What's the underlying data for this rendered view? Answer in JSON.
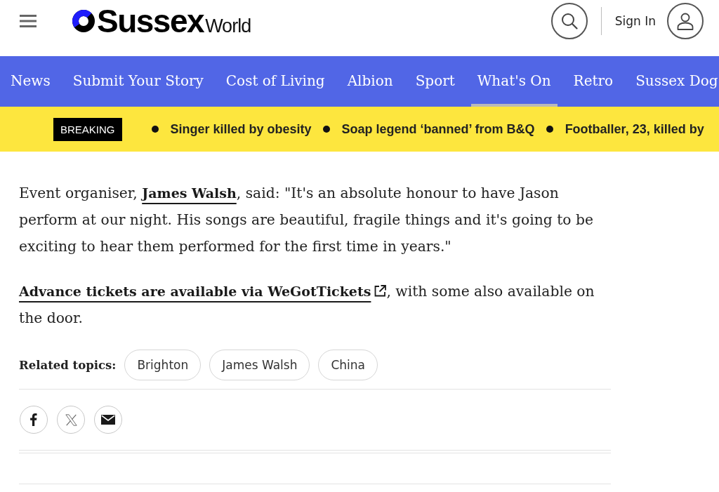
{
  "header": {
    "logo": {
      "wordmark": "Sussex",
      "suffix": "World"
    },
    "sign_in": "Sign In"
  },
  "nav": {
    "items": [
      {
        "label": "News",
        "selected": false
      },
      {
        "label": "Submit Your Story",
        "selected": false
      },
      {
        "label": "Cost of Living",
        "selected": false
      },
      {
        "label": "Albion",
        "selected": false
      },
      {
        "label": "Sport",
        "selected": false
      },
      {
        "label": "What's On",
        "selected": true
      },
      {
        "label": "Retro",
        "selected": false
      },
      {
        "label": "Sussex Dog",
        "selected": false
      }
    ]
  },
  "breaking_news": {
    "label": "BREAKING",
    "headlines": [
      "Singer killed by obesity",
      "Soap legend ‘banned’ from B&Q",
      "Footballer, 23, killed by"
    ]
  },
  "article": {
    "paragraphs": [
      {
        "parts": [
          {
            "kind": "text",
            "text": "Event organiser, "
          },
          {
            "kind": "link",
            "text": "James Walsh"
          },
          {
            "kind": "text",
            "text": ", said: \"It's an absolute honour to have Jason perform at our night. His songs are beautiful, fragile things and it's going to be exciting to hear them performed for the first time in years.\""
          }
        ]
      },
      {
        "parts": [
          {
            "kind": "extlink",
            "text": "Advance tickets are available via WeGotTickets"
          },
          {
            "kind": "text",
            "text": ", with some also available on the door."
          }
        ]
      }
    ],
    "related_topics": {
      "label": "Related topics:",
      "topics": [
        "Brighton",
        "James Walsh",
        "China"
      ]
    }
  }
}
